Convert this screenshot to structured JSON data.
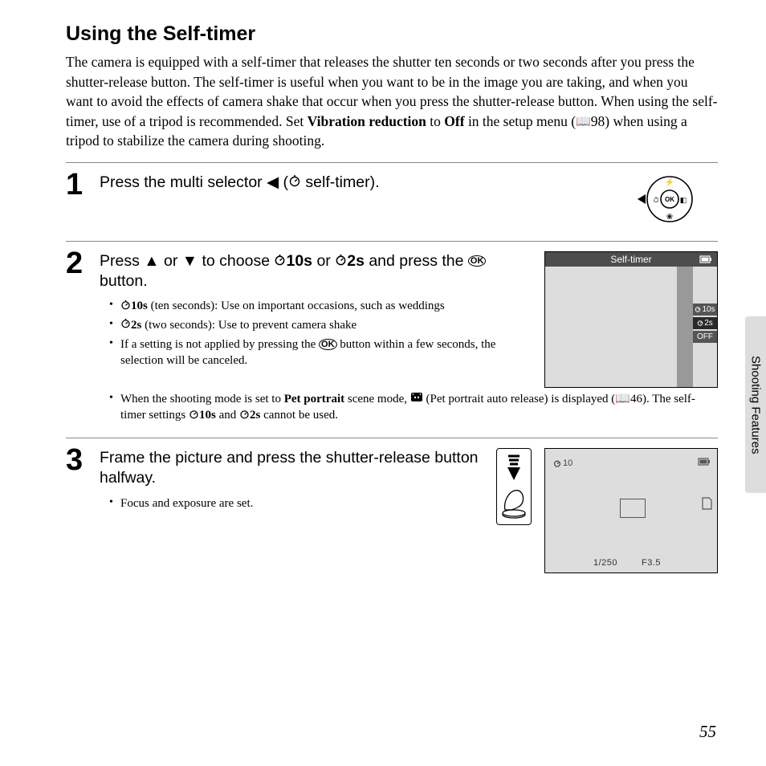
{
  "title": "Using the Self-timer",
  "intro": {
    "a": "The camera is equipped with a self-timer that releases the shutter ten seconds or two seconds after you press the shutter-release button. The self-timer is useful when you want to be in the image you are taking, and when you want to avoid the effects of camera shake that occur when you press the shutter-release button. When using the self-timer, use of a tripod is recommended. Set ",
    "vr": "Vibration reduction",
    "b": " to ",
    "off": "Off",
    "c": " in the setup menu (",
    "ref1": "98",
    "d": ") when using a tripod to stabilize the camera during shooting."
  },
  "step1": {
    "num": "1",
    "a": "Press the multi selector ",
    "b": " (",
    "c": " self-timer)."
  },
  "step2": {
    "num": "2",
    "a": "Press ",
    "b": " or ",
    "c": " to choose ",
    "opt10": "10s",
    "d": " or ",
    "opt2": "2s",
    "e": " and press the ",
    "ok": "k",
    "f": " button.",
    "bul1a": "10s",
    "bul1b": " (ten seconds): Use on important occasions, such as weddings",
    "bul2a": "2s",
    "bul2b": " (two seconds): Use to prevent camera shake",
    "bul3a": "If a setting is not applied by pressing the ",
    "bul3b": " button within a few seconds, the selection will be canceled.",
    "bul4a": "When the shooting mode is set to ",
    "bul4pet": "Pet portrait",
    "bul4b": " scene mode, ",
    "bul4c": " (Pet portrait auto release) is displayed (",
    "bul4ref": "46",
    "bul4d": "). The self-timer settings ",
    "bul4e": " and ",
    "bul4f": " cannot be used.",
    "screen_title": "Self-timer",
    "pill10": "10s",
    "pill2": "2s",
    "pilloff": "OFF"
  },
  "step3": {
    "num": "3",
    "head": "Frame the picture and press the shutter-release button halfway.",
    "bul1": "Focus and exposure are set.",
    "timer_label": "10",
    "shutter": "1/250",
    "aperture": "F3.5"
  },
  "side_tab": "Shooting Features",
  "page_number": "55"
}
